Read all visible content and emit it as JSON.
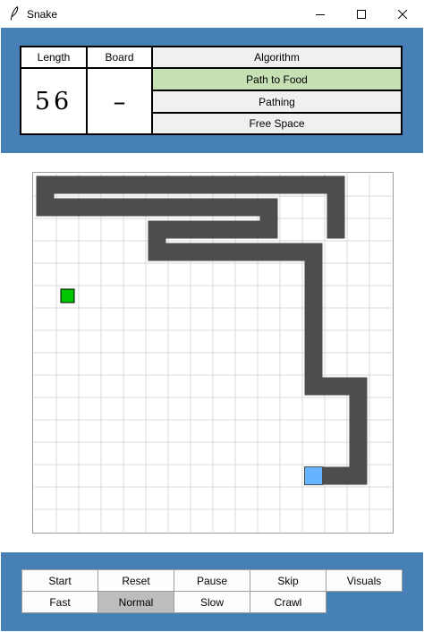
{
  "window": {
    "title": "Snake",
    "icon": "feather-icon",
    "controls": [
      "minimize-icon",
      "maximize-icon",
      "close-icon"
    ]
  },
  "stats": {
    "length_label": "Length",
    "length_value": "56",
    "board_label": "Board",
    "board_value": "–",
    "algorithm_label": "Algorithm",
    "algorithm_options": [
      {
        "label": "Path to Food",
        "active": true
      },
      {
        "label": "Pathing",
        "active": false
      },
      {
        "label": "Free Space",
        "active": false
      }
    ]
  },
  "colors": {
    "frame": "#4680b4",
    "active_option": "#c6e0b4",
    "option_bg": "#f0f0f0",
    "snake_body": "#4d4d4d",
    "snake_head": "#64b4ff",
    "food": "#00c800",
    "grid_line": "#d8d8d8",
    "selected_button": "#bdbdbd"
  },
  "board": {
    "cols": 16,
    "rows": 16,
    "food": [
      1,
      5
    ],
    "head": [
      12,
      13
    ],
    "snake_path": [
      [
        12,
        13
      ],
      [
        13,
        13
      ],
      [
        14,
        13
      ],
      [
        14,
        12
      ],
      [
        14,
        11
      ],
      [
        14,
        10
      ],
      [
        14,
        9
      ],
      [
        13,
        9
      ],
      [
        12,
        9
      ],
      [
        12,
        8
      ],
      [
        12,
        7
      ],
      [
        12,
        6
      ],
      [
        12,
        5
      ],
      [
        12,
        4
      ],
      [
        12,
        3
      ],
      [
        11,
        3
      ],
      [
        10,
        3
      ],
      [
        9,
        3
      ],
      [
        8,
        3
      ],
      [
        7,
        3
      ],
      [
        6,
        3
      ],
      [
        5,
        3
      ],
      [
        5,
        2
      ],
      [
        6,
        2
      ],
      [
        7,
        2
      ],
      [
        8,
        2
      ],
      [
        9,
        2
      ],
      [
        10,
        2
      ],
      [
        10,
        1
      ],
      [
        9,
        1
      ],
      [
        8,
        1
      ],
      [
        7,
        1
      ],
      [
        6,
        1
      ],
      [
        5,
        1
      ],
      [
        4,
        1
      ],
      [
        3,
        1
      ],
      [
        2,
        1
      ],
      [
        1,
        1
      ],
      [
        0,
        1
      ],
      [
        0,
        0
      ],
      [
        1,
        0
      ],
      [
        2,
        0
      ],
      [
        3,
        0
      ],
      [
        4,
        0
      ],
      [
        5,
        0
      ],
      [
        6,
        0
      ],
      [
        7,
        0
      ],
      [
        8,
        0
      ],
      [
        9,
        0
      ],
      [
        10,
        0
      ],
      [
        11,
        0
      ],
      [
        12,
        0
      ],
      [
        13,
        0
      ],
      [
        13,
        1
      ],
      [
        13,
        2
      ]
    ]
  },
  "controls": {
    "row1": [
      "Start",
      "Reset",
      "Pause",
      "Skip",
      "Visuals"
    ],
    "row2": [
      "Fast",
      "Normal",
      "Slow",
      "Crawl"
    ],
    "selected_speed": "Normal"
  }
}
